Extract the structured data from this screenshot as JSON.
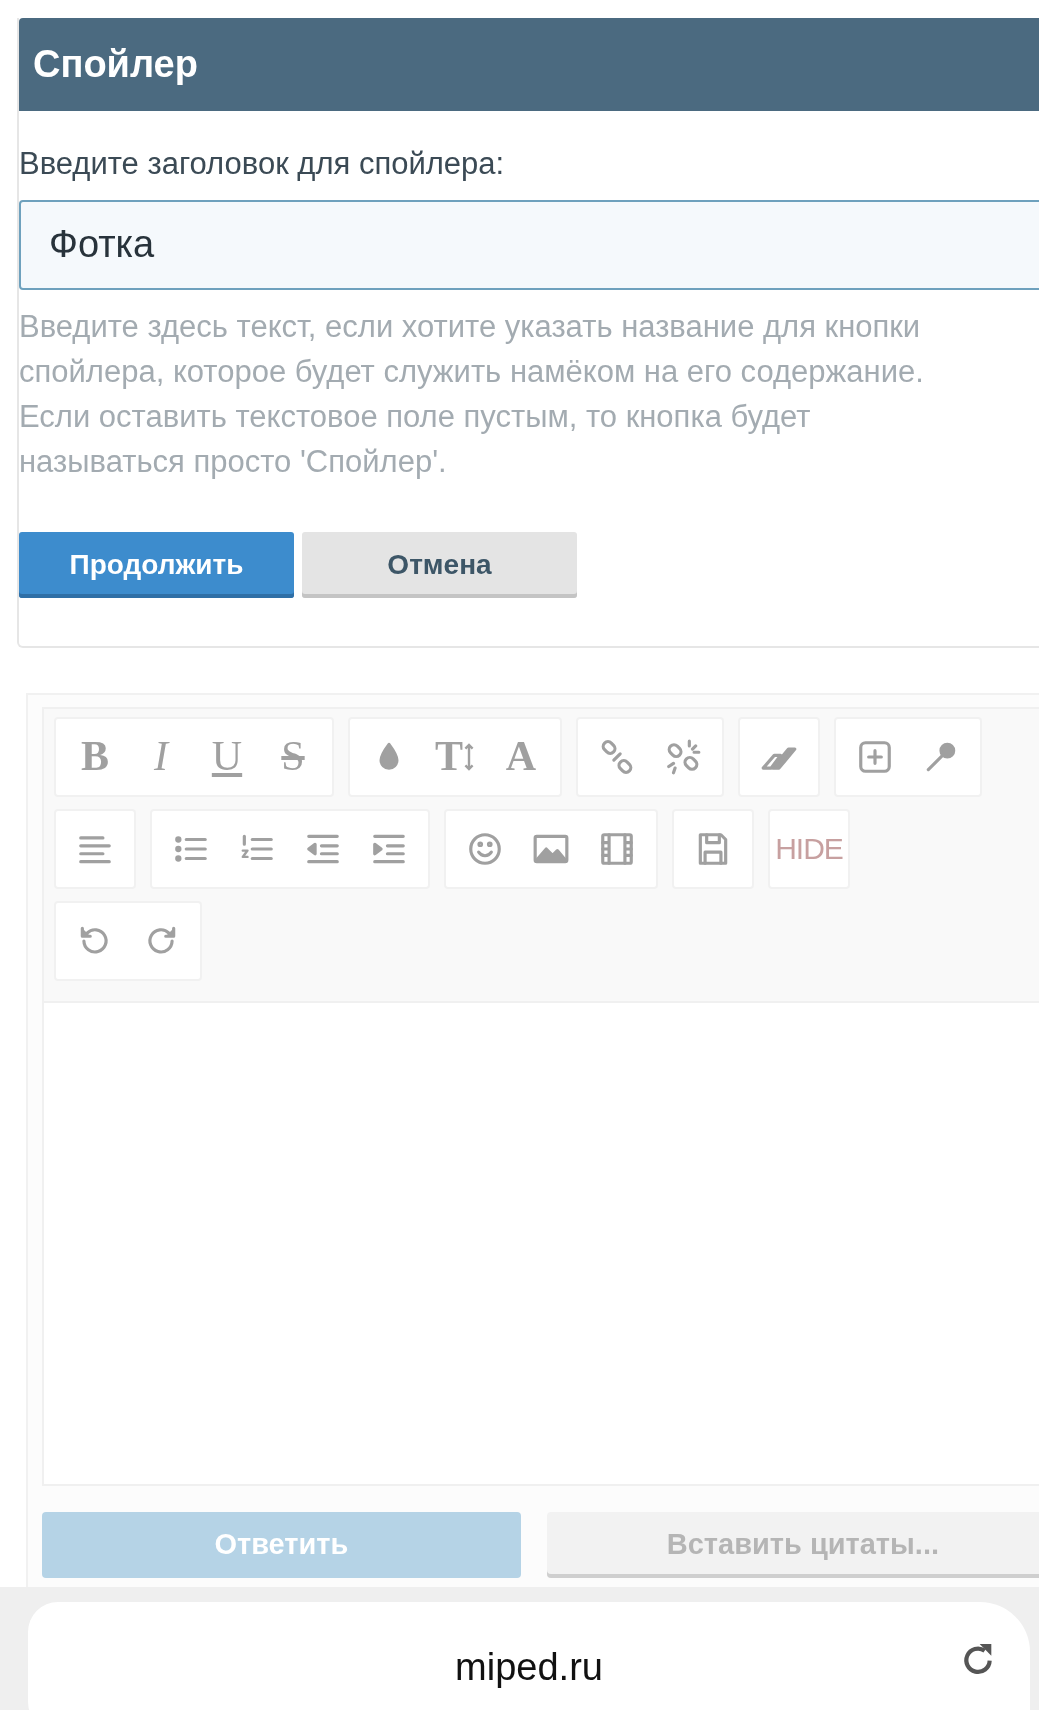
{
  "dialog": {
    "title": "Спойлер",
    "field_label": "Введите заголовок для спойлера:",
    "field_value": "Фотка",
    "help_text": "Введите здесь текст, если хотите указать название для кнопки спойлера, которое будет служить намёком на его содержание. Если оставить текстовое поле пустым, то кнопка будет называться просто 'Спойлер'.",
    "buttons": [
      {
        "label": "Продолжить",
        "kind": "primary"
      },
      {
        "label": "Отмена",
        "kind": "secondary"
      }
    ]
  },
  "toolbar": {
    "rows": [
      [
        {
          "buttons": [
            {
              "kind": "glyph",
              "label": "B"
            },
            {
              "kind": "glyph",
              "label": "I"
            },
            {
              "kind": "glyph",
              "label": "U"
            },
            {
              "kind": "glyph",
              "label": "S"
            }
          ]
        },
        {
          "buttons": [
            {
              "kind": "icon"
            },
            {
              "kind": "glyph",
              "label": "T"
            },
            {
              "kind": "glyph",
              "label": "A"
            }
          ]
        },
        {
          "buttons": [
            {
              "kind": "icon"
            },
            {
              "kind": "icon"
            }
          ]
        },
        {
          "buttons": [
            {
              "kind": "icon"
            }
          ]
        },
        {
          "buttons": [
            {
              "kind": "icon"
            },
            {
              "kind": "icon"
            }
          ]
        }
      ],
      [
        {
          "buttons": [
            {
              "kind": "icon"
            }
          ]
        },
        {
          "buttons": [
            {
              "kind": "icon"
            },
            {
              "kind": "icon"
            },
            {
              "kind": "icon"
            },
            {
              "kind": "icon"
            }
          ]
        },
        {
          "buttons": [
            {
              "kind": "icon"
            },
            {
              "kind": "icon"
            },
            {
              "kind": "icon"
            }
          ]
        },
        {
          "buttons": [
            {
              "kind": "icon"
            }
          ]
        },
        {
          "buttons": [
            {
              "kind": "glyph",
              "label": "HIDE"
            }
          ]
        }
      ],
      [
        {
          "buttons": [
            {
              "kind": "icon"
            },
            {
              "kind": "icon"
            }
          ]
        }
      ]
    ]
  },
  "actions": [
    {
      "label": "Ответить",
      "kind": "primary",
      "disabled": true
    },
    {
      "label": "Вставить цитаты...",
      "kind": "secondary",
      "disabled": true
    }
  ],
  "address_bar": {
    "url": "miped.ru"
  }
}
